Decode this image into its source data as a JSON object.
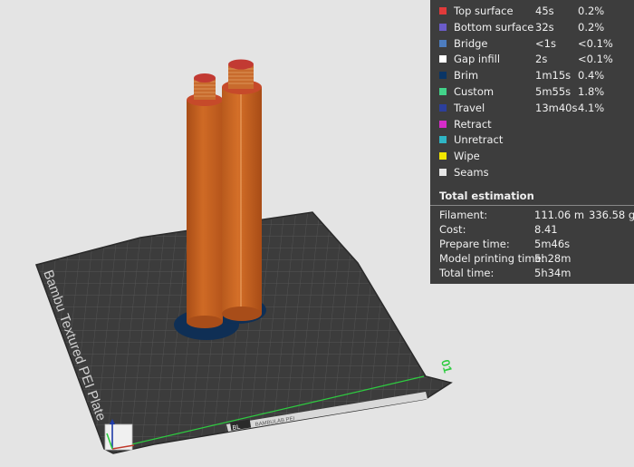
{
  "plate": {
    "label": "Bambu Textured PEI Plate",
    "number": "01",
    "logo_text": "BL",
    "strip_text": "BAMBULAB PEI"
  },
  "legend": [
    {
      "label": "Top surface",
      "time": "45s",
      "percent": "0.2%",
      "color": "#e13a3a"
    },
    {
      "label": "Bottom surface",
      "time": "32s",
      "percent": "0.2%",
      "color": "#6b5cc9"
    },
    {
      "label": "Bridge",
      "time": "<1s",
      "percent": "<0.1%",
      "color": "#4d7dbf"
    },
    {
      "label": "Gap infill",
      "time": "2s",
      "percent": "<0.1%",
      "color": "#ffffff"
    },
    {
      "label": "Brim",
      "time": "1m15s",
      "percent": "0.4%",
      "color": "#0a3566"
    },
    {
      "label": "Custom",
      "time": "5m55s",
      "percent": "1.8%",
      "color": "#43d38a"
    },
    {
      "label": "Travel",
      "time": "13m40s",
      "percent": "4.1%",
      "color": "#2c3f9c"
    },
    {
      "label": "Retract",
      "time": "",
      "percent": "",
      "color": "#d62cc8"
    },
    {
      "label": "Unretract",
      "time": "",
      "percent": "",
      "color": "#2fb5c5"
    },
    {
      "label": "Wipe",
      "time": "",
      "percent": "",
      "color": "#f2e600"
    },
    {
      "label": "Seams",
      "time": "",
      "percent": "",
      "color": "#e6e6e6"
    }
  ],
  "total_estimation": {
    "title": "Total estimation",
    "filament_label": "Filament:",
    "filament_length": "111.06 m",
    "filament_weight": "336.58 g",
    "cost_label": "Cost:",
    "cost_value": "8.41",
    "prepare_label": "Prepare time:",
    "prepare_value": "5m46s",
    "model_label": "Model printing time:",
    "model_value": "5h28m",
    "total_label": "Total time:",
    "total_value": "5h34m"
  }
}
